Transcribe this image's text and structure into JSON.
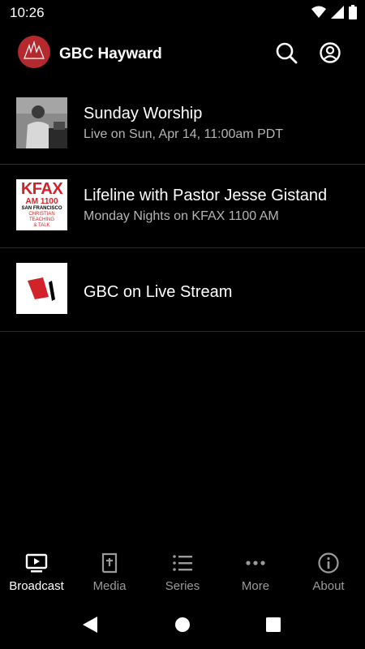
{
  "status_bar": {
    "time": "10:26"
  },
  "app_bar": {
    "title": "GBC Hayward"
  },
  "list": [
    {
      "title": "Sunday Worship",
      "subtitle": "Live on Sun, Apr 14, 11:00am PDT",
      "thumb": "pastor-photo"
    },
    {
      "title": "Lifeline with Pastor Jesse Gistand",
      "subtitle": "Monday Nights on KFAX 1100 AM",
      "thumb": "kfax-logo",
      "thumb_text": {
        "line1": "KFAX",
        "line2": "AM 1100",
        "line3": "SAN FRANCISCO",
        "line4": "CHRISTIAN",
        "line5": "TEACHING",
        "line6": "& TALK"
      }
    },
    {
      "title": "GBC on Live Stream",
      "subtitle": "",
      "thumb": "livestream-logo"
    }
  ],
  "bottom_nav": [
    {
      "label": "Broadcast",
      "icon": "tv-icon",
      "active": true
    },
    {
      "label": "Media",
      "icon": "bible-icon",
      "active": false
    },
    {
      "label": "Series",
      "icon": "list-icon",
      "active": false
    },
    {
      "label": "More",
      "icon": "more-icon",
      "active": false
    },
    {
      "label": "About",
      "icon": "info-icon",
      "active": false
    }
  ],
  "colors": {
    "background": "#000000",
    "logo_red": "#b3292e",
    "kfax_red": "#d2232a",
    "subtitle": "#b5b5b5",
    "inactive": "#9a9a9a"
  }
}
